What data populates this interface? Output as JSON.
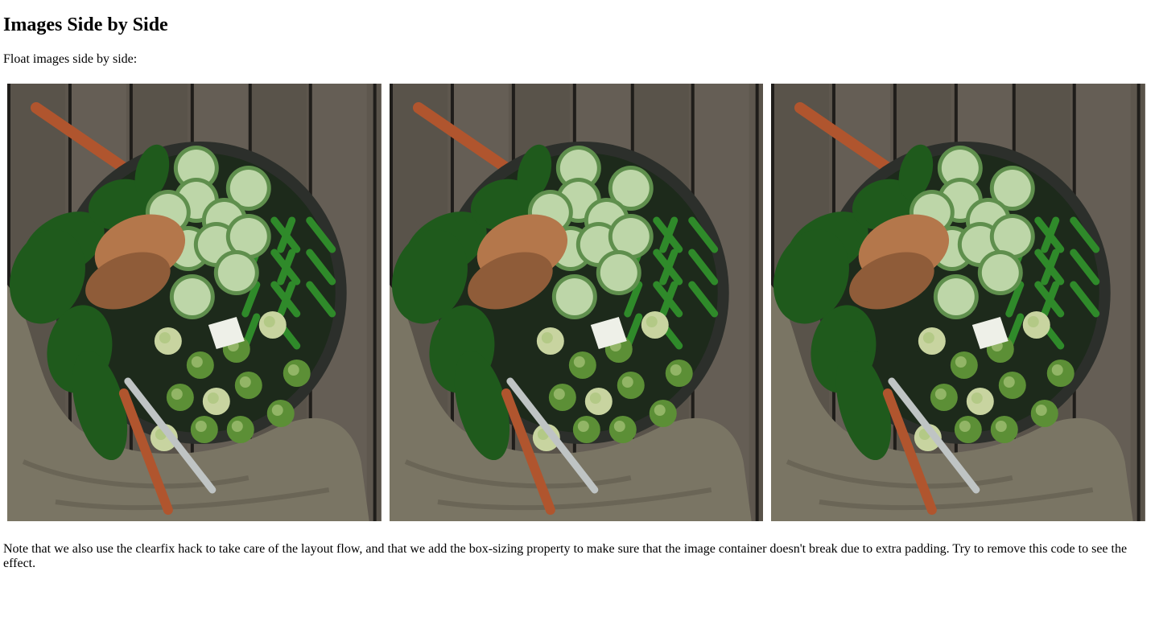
{
  "page": {
    "heading": "Images Side by Side",
    "intro": "Float images side by side:",
    "note": "Note that we also use the clearfix hack to take care of the layout flow, and that we add the box-sizing property to make sure that the image container doesn't break due to extra padding. Try to remove this code to see the effect."
  },
  "gallery": {
    "images": [
      {
        "subject": "salad-bowl"
      },
      {
        "subject": "salad-bowl"
      },
      {
        "subject": "salad-bowl"
      }
    ]
  },
  "colors": {
    "wood": "#5e574e",
    "wood_gap": "#1f1d1a",
    "bowl": "#2c2f2b",
    "cucumber": "#bdd6a8",
    "greens": "#1f5a1c",
    "bread": "#b4774b",
    "utensil": "#b0552e",
    "burlap": "#7a7564"
  }
}
